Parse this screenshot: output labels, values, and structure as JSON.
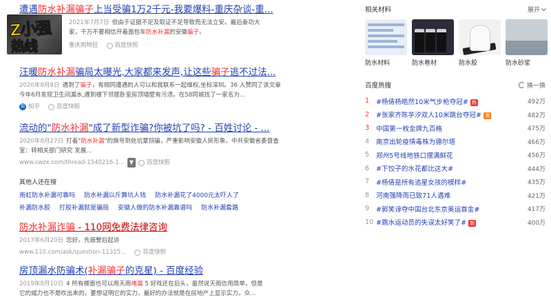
{
  "results": [
    {
      "title_pre": "遭遇",
      "title_em": "防水补漏骗子",
      "title_post": "上当受骗1万2千元-我要爆料-重庆杂谈-重...",
      "date": "2021年7月7日",
      "snippet1": "但由于证据不足及取证不足导致而无法立安。最后泰功大",
      "snippet2_pre": "家，千万不要相信开着面包车",
      "snippet2_em": "防水补漏",
      "snippet2_post": "的安徽",
      "snippet2_em2": "骗子",
      "snippet2_end": "。",
      "source": "重庆购物狂",
      "snapshot": "百度快照"
    },
    {
      "title_pre": "汪暖",
      "title_em": "防水补漏",
      "title_mid": "骗局太曝光,大家都来发声,让这些",
      "title_em2": "骗子",
      "title_post": "逃不过法...",
      "date": "2020年8月8日",
      "snippet1_pre": "遇到了",
      "snippet1_em": "骗子",
      "snippet1_post": "，有相同遭遇的人可以和我联系一起维权,坐标深圳。36 人赞同了该文章",
      "snippet2": "今年6月发现卫生间漏水,遇到楼下邻居卧室房顶墙壁有污渍。在58同城找了一家名为...",
      "source": "知乎",
      "source_icon": "知",
      "snapshot": "百度快照"
    },
    {
      "title_pre": "流动的\"",
      "title_em": "防水补漏",
      "title_post": "\"成了新型诈骗?你被坑了吗? - 百姓讨论 - ...",
      "date": "2020年8月27日",
      "snippet1_pre": "打着\"",
      "snippet1_em": "防水补漏",
      "snippet1_post": "\"的旗号到处坑蒙拐骗，严重影响安徽人民形象。中共安徽省委督查",
      "snippet2": "室：转相关部门研究 发展...",
      "url": "www.swzx.com/thread-1540216-1...",
      "code": "▼",
      "snapshot": "百度快照"
    },
    {
      "title_em": "防水补漏诈骗",
      "title_post": " - 110网免费法律咨询",
      "date": "2017年6月20日",
      "snippet": "您好，先报警后起诉",
      "url": "www.110.com/ask/question-11315...",
      "snapshot": "百度快照"
    },
    {
      "title_pre": "房顶漏水防骗术(",
      "title_em": "补漏骗子",
      "title_post": "的克星) - 百度经验",
      "date": "2019年8月10日",
      "snippet1_pre": "4 所有楼面也可以用天雨",
      "snippet1_em": "堵漏",
      "snippet1_post": " 5 好戏还在后头，虽然说天雨信用简单，但是",
      "snippet2": "它的威力也不是吹出来的，要想证明它的实力，最好的办法就是在房地产上显示实力，众..."
    }
  ],
  "related": {
    "heading": "其他人还在搜",
    "row1": [
      "雨虹防水补漏可靠吗",
      "防水补漏以斤算坑人钱",
      "防水补漏花了4000元太吓人了"
    ],
    "row2": [
      "补漏防水胶",
      "打胶补漏就是骗局",
      "安徽人做的防水补漏靠谱吗",
      "防水补漏套路"
    ]
  },
  "logo": {
    "line1": "Z小强",
    "line2": "热线"
  },
  "sidebar": {
    "materials_title": "相关材料",
    "expand": "展开",
    "materials": [
      {
        "label": "防水材料",
        "icon": "doc-thumbnail-icon"
      },
      {
        "label": "防水卷材",
        "icon": "rolls-thumbnail-icon"
      },
      {
        "label": "防水胶",
        "icon": "tape-thumbnail-icon"
      },
      {
        "label": "防水砂浆",
        "icon": "wall-thumbnail-icon"
      }
    ],
    "hot_title": "百度热搜",
    "refresh": "换一换",
    "hot": [
      {
        "rank": "1",
        "text": "#杨倩杨皓然10米气步枪夺冠#",
        "badge": "热",
        "count": "492万"
      },
      {
        "rank": "2",
        "text": "#张家齐陈芋汐双人10米跳台夺冠#",
        "badge": "沸",
        "count": "482万"
      },
      {
        "rank": "3",
        "text": "中国第一枚金牌九百格",
        "badge": "",
        "count": "475万"
      },
      {
        "rank": "4",
        "text": "南京出轮疫情毒株为德尔塔",
        "badge": "",
        "count": "466万"
      },
      {
        "rank": "5",
        "text": "郑州5号线地铁口摆满鲜花",
        "badge": "",
        "count": "456万"
      },
      {
        "rank": "6",
        "text": "#下饺子的水花都比这大#",
        "badge": "",
        "count": "444万"
      },
      {
        "rank": "7",
        "text": "#杨倩是所有追星女孩的模样#",
        "badge": "",
        "count": "435万"
      },
      {
        "rank": "8",
        "text": "河南强降雨已致71人遇难",
        "badge": "",
        "count": "421万"
      },
      {
        "rank": "9",
        "text": "#郭笑谆夺中国台北东京奥运首金#",
        "badge": "",
        "count": "417万"
      },
      {
        "rank": "10",
        "text": "#跳水运动员的失误太好笑了#",
        "badge": "新",
        "count": "400万"
      }
    ]
  }
}
